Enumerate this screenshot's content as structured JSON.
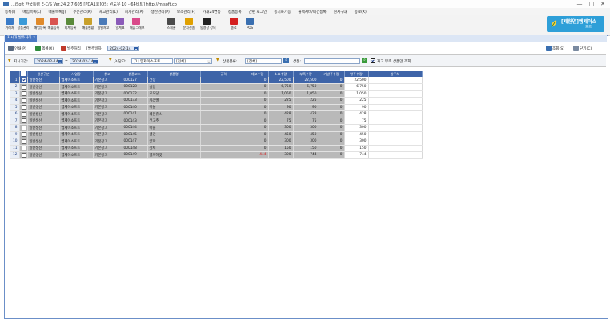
{
  "window": {
    "title": "...iSoft 한국통령 E-C/S Ver.24.2.7.605 [PDA1호]OS: 윈도우 10 - 64비트] http://mjsoft.co",
    "minimize": "—",
    "maximize": "□",
    "close": "✕"
  },
  "menu": [
    "등록(I)",
    "매입목록(L)",
    "매출목록(J)",
    "주문관리(K)",
    "재고관리(L)",
    "회계관리(A)",
    "생산관리(P)",
    "보조관리(F)",
    "가재24연동",
    "정품등록",
    "간편 로그인",
    "동기화기능",
    "플렉서비/미건등록",
    "원지구대",
    "종료(X)"
  ],
  "toolbar": [
    {
      "label": "거래처",
      "color": "#3a7bc8"
    },
    {
      "label": "상품관리",
      "color": "#3a9ad8"
    },
    {
      "label": "매입등록",
      "color": "#e08a2a"
    },
    {
      "label": "매출등록",
      "color": "#d9534f"
    },
    {
      "label": "회계등록",
      "color": "#5a8a3a"
    },
    {
      "label": "매출현황",
      "color": "#c8a02a"
    },
    {
      "label": "일별재고",
      "color": "#4a7ab8"
    },
    {
      "label": "일계표",
      "color": "#8a5ab8"
    },
    {
      "label": "매출그래프",
      "color": "#d94a8a"
    },
    {
      "label": "스케쥴",
      "color": "#4a4a4a"
    },
    {
      "label": "문자전송",
      "color": "#e0a000"
    },
    {
      "label": "동영상 강의",
      "color": "#222222"
    },
    {
      "label": "종료",
      "color": "#d42020"
    },
    {
      "label": "POS",
      "color": "#3a6fb0"
    }
  ],
  "brand": {
    "line1": "[제헌연]엠제이소",
    "line2": "프트"
  },
  "tab": {
    "label": "지시대 발주처리",
    "close": "x"
  },
  "actions": {
    "print": "인쇄(P)",
    "excel": "엑셀(X)",
    "order": "발주처리",
    "order_date_label": "[발주일자:",
    "order_date": "2024-02-14",
    "search": "조회(S)",
    "close": "닫기(C)"
  },
  "filters": {
    "date_label": "지시기간:",
    "date_from": "2024-02-14",
    "date_to": "2024-02-14",
    "vendor_label": "入당고:",
    "vendor_value": "[1] 엠제이소프트",
    "vendor_code": "[전체]",
    "category_label": "상품분류:",
    "category_value": "[전체]",
    "product_label": "상품:",
    "product_value": "",
    "stock_check": "재고 부족 상품만 조회"
  },
  "table": {
    "headers": [
      "",
      "",
      "생산구분",
      "사업장",
      "창고",
      "상품코드",
      "상품명",
      "규격",
      "재고수량",
      "소요수량",
      "부족수량",
      "기발주수량",
      "발주수량",
      "발주처"
    ],
    "rows": [
      {
        "n": "1",
        "type": "일반생산",
        "site": "엠제이소프트",
        "wh": "기본창고",
        "code": "000127",
        "name": "간장",
        "spec": "",
        "stock": "0",
        "need": "22,500",
        "short": "22,500",
        "pre": "0",
        "qty": "22,500",
        "vendor": "",
        "checked": true
      },
      {
        "n": "2",
        "type": "일반생산",
        "site": "엠제이소프트",
        "wh": "기본창고",
        "code": "000128",
        "name": "설탕",
        "spec": "",
        "stock": "0",
        "need": "6,750",
        "short": "6,750",
        "pre": "0",
        "qty": "6,750",
        "vendor": "",
        "checked": false
      },
      {
        "n": "3",
        "type": "일반생산",
        "site": "엠제이소프트",
        "wh": "기본창고",
        "code": "000132",
        "name": "포도당",
        "spec": "",
        "stock": "0",
        "need": "1,050",
        "short": "1,050",
        "pre": "0",
        "qty": "1,050",
        "vendor": "",
        "checked": false
      },
      {
        "n": "4",
        "type": "일반생산",
        "site": "엠제이소프트",
        "wh": "기본창고",
        "code": "000133",
        "name": "카라멜",
        "spec": "",
        "stock": "0",
        "need": "225",
        "short": "225",
        "pre": "0",
        "qty": "225",
        "vendor": "",
        "checked": false
      },
      {
        "n": "5",
        "type": "일반생산",
        "site": "엠제이소프트",
        "wh": "기본창고",
        "code": "000140",
        "name": "마늘",
        "spec": "",
        "stock": "0",
        "need": "90",
        "short": "90",
        "pre": "0",
        "qty": "90",
        "vendor": "",
        "checked": false
      },
      {
        "n": "6",
        "type": "일반생산",
        "site": "엠제이소프트",
        "wh": "기본창고",
        "code": "000141",
        "name": "레몬쥬스",
        "spec": "",
        "stock": "0",
        "need": "428",
        "short": "428",
        "pre": "0",
        "qty": "428",
        "vendor": "",
        "checked": false
      },
      {
        "n": "7",
        "type": "일반생산",
        "site": "엠제이소프트",
        "wh": "기본창고",
        "code": "000143",
        "name": "건고추",
        "spec": "",
        "stock": "0",
        "need": "75",
        "short": "75",
        "pre": "0",
        "qty": "75",
        "vendor": "",
        "checked": false
      },
      {
        "n": "8",
        "type": "일반생산",
        "site": "엠제이소프트",
        "wh": "기본창고",
        "code": "000144",
        "name": "마늘",
        "spec": "",
        "stock": "0",
        "need": "300",
        "short": "300",
        "pre": "0",
        "qty": "300",
        "vendor": "",
        "checked": false
      },
      {
        "n": "9",
        "type": "일반생산",
        "site": "엠제이소프트",
        "wh": "기본창고",
        "code": "000145",
        "name": "생강",
        "spec": "",
        "stock": "0",
        "need": "450",
        "short": "450",
        "pre": "0",
        "qty": "450",
        "vendor": "",
        "checked": false
      },
      {
        "n": "10",
        "type": "일반생산",
        "site": "엠제이소프트",
        "wh": "기본창고",
        "code": "000147",
        "name": "양파",
        "spec": "",
        "stock": "0",
        "need": "300",
        "short": "300",
        "pre": "0",
        "qty": "300",
        "vendor": "",
        "checked": false
      },
      {
        "n": "11",
        "type": "일반생산",
        "site": "엠제이소프트",
        "wh": "기본창고",
        "code": "000148",
        "name": "감채",
        "spec": "",
        "stock": "0",
        "need": "150",
        "short": "150",
        "pre": "0",
        "qty": "150",
        "vendor": "",
        "checked": false
      },
      {
        "n": "12",
        "type": "일반생산",
        "site": "엠제이소프트",
        "wh": "기본창고",
        "code": "000149",
        "name": "엘지하켓",
        "spec": "",
        "stock": "-444",
        "need": "300",
        "short": "744",
        "pre": "0",
        "qty": "744",
        "vendor": "",
        "checked": false
      }
    ]
  }
}
